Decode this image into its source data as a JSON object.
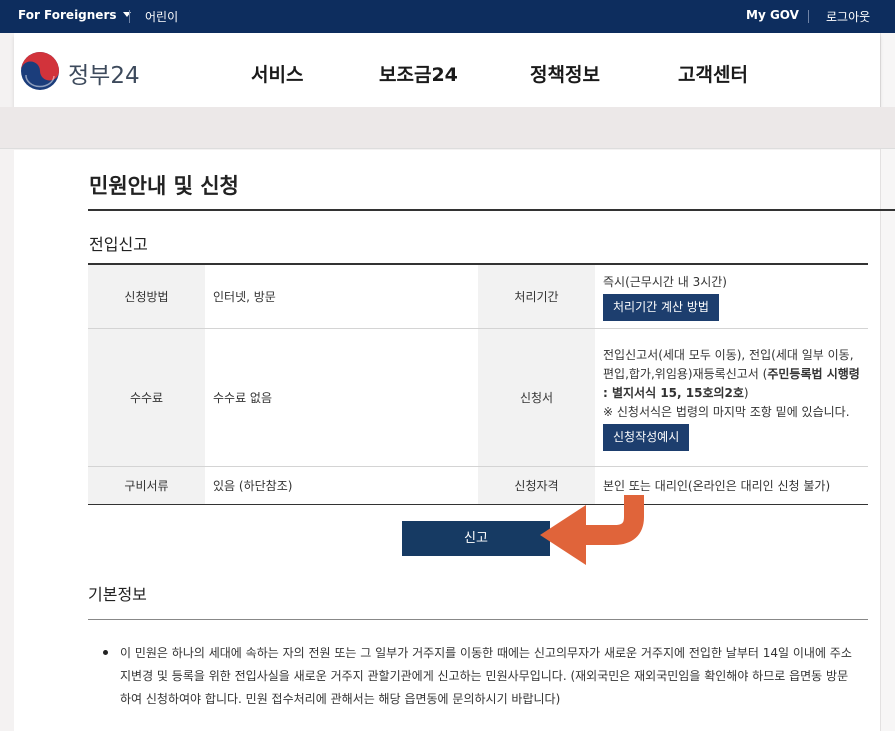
{
  "topbar": {
    "for_foreigners": "For Foreigners",
    "kids": "어린이",
    "my_gov": "My GOV",
    "logout": "로그아웃"
  },
  "header": {
    "logo_text": "정부24",
    "nav": [
      "서비스",
      "보조금24",
      "정책정보",
      "고객센터"
    ]
  },
  "page": {
    "title": "민원안내 및 신청",
    "subtitle": "전입신고"
  },
  "info_table": {
    "method_label": "신청방법",
    "method_value": "인터넷, 방문",
    "period_label": "처리기간",
    "period_value": "즉시(근무시간 내 3시간)",
    "period_button": "처리기간 계산 방법",
    "fee_label": "수수료",
    "fee_value": "수수료 없음",
    "form_label": "신청서",
    "form_text_1": "전입신고서(세대 모두 이동), 전입(세대 일부 이동, 편입,합가,위임용)재등록신고서 (",
    "form_text_bold": "주민등록법 시행령 : 별지서식 15, 15호의2호",
    "form_text_2": ")",
    "form_note": "※ 신청서식은 법령의 마지막 조항 밑에 있습니다.",
    "form_button": "신청작성예시",
    "docs_label": "구비서류",
    "docs_value": "있음 (하단참조)",
    "qual_label": "신청자격",
    "qual_value": "본인 또는 대리인(온라인은 대리인 신청 불가)"
  },
  "apply_button": "신고",
  "basic_info": {
    "title": "기본정보",
    "description": "이 민원은 하나의 세대에 속하는 자의 전원 또는 그 일부가 거주지를 이동한 때에는 신고의무자가 새로운 거주지에 전입한 날부터 14일 이내에 주소지변경 및 등록을 위한 전입사실을 새로운 거주지 관할기관에게 신고하는 민원사무입니다. (재외국민은 재외국민임을 확인해야 하므로 읍면동 방문하여 신청하여야 합니다. 민원 접수처리에 관해서는 해당 읍면동에 문의하시기 바랍니다)"
  },
  "colors": {
    "topbar": "#0d2d5e",
    "button": "#1d3e6e",
    "arrow": "#e0643a"
  }
}
